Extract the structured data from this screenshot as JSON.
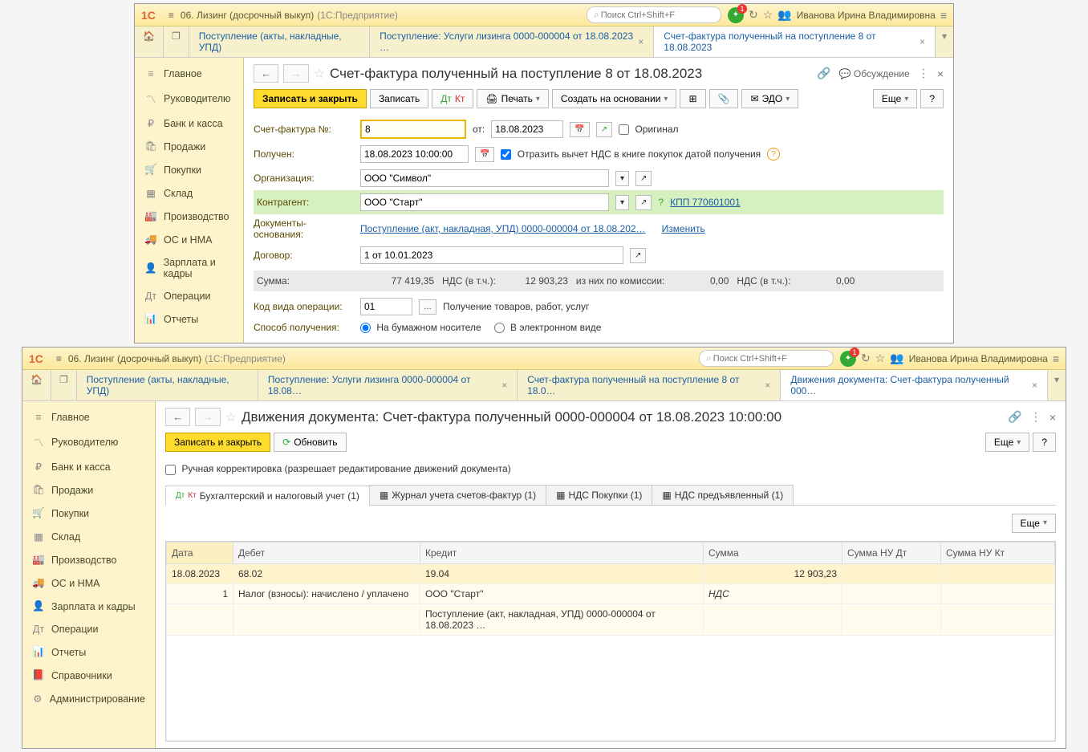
{
  "win1": {
    "title": "06. Лизинг (досрочный выкуп)",
    "title_sub": "(1С:Предприятие)",
    "search_ph": "Поиск Ctrl+Shift+F",
    "user": "Иванова Ирина Владимировна",
    "badge": "1",
    "tabs": [
      "Поступление (акты, накладные, УПД)",
      "Поступление: Услуги лизинга 0000-000004 от 18.08.2023 …",
      "Счет-фактура полученный на поступление 8 от 18.08.2023"
    ],
    "sidebar": [
      "Главное",
      "Руководителю",
      "Банк и касса",
      "Продажи",
      "Покупки",
      "Склад",
      "Производство",
      "ОС и НМА",
      "Зарплата и кадры",
      "Операции",
      "Отчеты"
    ],
    "page_title": "Счет-фактура полученный на поступление 8 от 18.08.2023",
    "discuss": "Обсуждение",
    "toolbar": {
      "save_close": "Записать и закрыть",
      "save": "Записать",
      "print": "Печать",
      "create_based": "Создать на основании",
      "edo": "ЭДО",
      "more": "Еще",
      "help": "?"
    },
    "form": {
      "invoice_no_label": "Счет-фактура №:",
      "invoice_no": "8",
      "from_label": "от:",
      "from_date": "18.08.2023",
      "original": "Оригинал",
      "received_label": "Получен:",
      "received": "18.08.2023 10:00:00",
      "reflect": "Отразить вычет НДС в книге покупок датой получения",
      "org_label": "Организация:",
      "org": "ООО \"Символ\"",
      "contragent_label": "Контрагент:",
      "contragent": "ООО \"Старт\"",
      "kpp": "КПП 770601001",
      "docs_label": "Документы-основания:",
      "docs_link": "Поступление (акт, накладная, УПД) 0000-000004 от 18.08.202…",
      "change": "Изменить",
      "contract_label": "Договор:",
      "contract": "1 от 10.01.2023",
      "sum_label": "Сумма:",
      "sum": "77 419,35",
      "vat_label": "НДС (в т.ч.):",
      "vat": "12 903,23",
      "commission_label": "из них по комиссии:",
      "commission": "0,00",
      "vat2_label": "НДС (в т.ч.):",
      "vat2": "0,00",
      "op_code_label": "Код вида операции:",
      "op_code": "01",
      "op_code_desc": "Получение товаров, работ, услуг",
      "method_label": "Способ получения:",
      "method_paper": "На бумажном носителе",
      "method_elec": "В электронном виде"
    }
  },
  "win2": {
    "title": "06. Лизинг (досрочный выкуп)",
    "title_sub": "(1С:Предприятие)",
    "search_ph": "Поиск Ctrl+Shift+F",
    "user": "Иванова Ирина Владимировна",
    "badge": "1",
    "tabs": [
      "Поступление (акты, накладные, УПД)",
      "Поступление: Услуги лизинга 0000-000004 от 18.08…",
      "Счет-фактура полученный на поступление 8 от 18.0…",
      "Движения документа: Счет-фактура полученный 000…"
    ],
    "sidebar": [
      "Главное",
      "Руководителю",
      "Банк и касса",
      "Продажи",
      "Покупки",
      "Склад",
      "Производство",
      "ОС и НМА",
      "Зарплата и кадры",
      "Операции",
      "Отчеты",
      "Справочники",
      "Администрирование"
    ],
    "page_title": "Движения документа: Счет-фактура полученный 0000-000004 от 18.08.2023 10:00:00",
    "toolbar": {
      "save_close": "Записать и закрыть",
      "refresh": "Обновить",
      "more": "Еще",
      "help": "?"
    },
    "manual": "Ручная корректировка (разрешает редактирование движений документа)",
    "tabs2": [
      "Бухгалтерский и налоговый учет (1)",
      "Журнал учета счетов-фактур (1)",
      "НДС Покупки (1)",
      "НДС предъявленный (1)"
    ],
    "grid": {
      "headers": [
        "Дата",
        "Дебет",
        "Кредит",
        "Сумма",
        "Сумма НУ Дт",
        "Сумма НУ Кт"
      ],
      "row1": {
        "date": "18.08.2023",
        "debit": "68.02",
        "credit": "19.04",
        "sum": "12 903,23"
      },
      "row2": {
        "n": "1",
        "debit": "Налог (взносы): начислено / уплачено",
        "credit": "ООО \"Старт\"",
        "sum": "НДС"
      },
      "row3": {
        "credit": "Поступление (акт, накладная, УПД) 0000-000004 от 18.08.2023 …"
      }
    },
    "more2": "Еще"
  }
}
